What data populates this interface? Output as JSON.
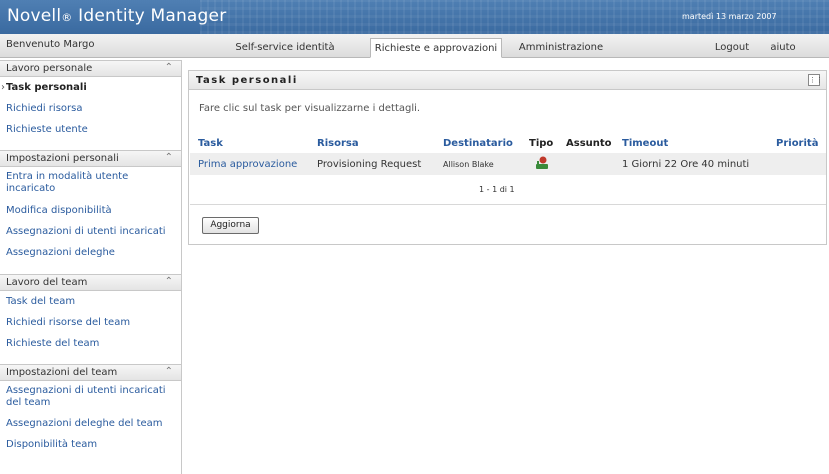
{
  "header": {
    "brand": "Novell",
    "brand_mark": "®",
    "brand_product": "Identity Manager",
    "date": "martedì 13 marzo 2007"
  },
  "nav": {
    "welcome": "Benvenuto Margo",
    "tabs": [
      {
        "label": "Self-service identità",
        "active": false
      },
      {
        "label": "Richieste e approvazioni",
        "active": true
      },
      {
        "label": "Amministrazione",
        "active": false
      }
    ],
    "logout": "Logout",
    "help": "aiuto"
  },
  "sidebar": {
    "sections": [
      {
        "title": "Lavoro personale",
        "items": [
          "Task personali",
          "Richiedi risorsa",
          "Richieste utente"
        ]
      },
      {
        "title": "Impostazioni personali",
        "items": [
          "Entra in modalità utente incaricato",
          "Modifica disponibilità",
          "Assegnazioni di utenti incaricati",
          "Assegnazioni deleghe"
        ]
      },
      {
        "title": "Lavoro del team",
        "items": [
          "Task del team",
          "Richiedi risorse del team",
          "Richieste del team"
        ]
      },
      {
        "title": "Impostazioni del team",
        "items": [
          "Assegnazioni di utenti incaricati del team",
          "Assegnazioni deleghe del team",
          "Disponibilità team"
        ]
      }
    ],
    "selected": "Task personali",
    "collapse_glyph": "⌃"
  },
  "panel": {
    "title": "Task personali",
    "icon": "grid-icon",
    "instructions": "Fare clic sul task per visualizzarne i dettagli.",
    "columns": [
      "Task",
      "Risorsa",
      "Destinatario",
      "Tipo",
      "Assunto",
      "Timeout",
      "Priorità"
    ],
    "rows": [
      {
        "task": "Prima approvazione",
        "resource": "Provisioning Request",
        "recipient": "Allison Blake",
        "type_icon": "approval-type-icon",
        "assigned": "",
        "timeout": "1 Giorni 22 Ore 40 minuti",
        "priority": ""
      }
    ],
    "pager": "1 - 1 di 1",
    "refresh_button": "Aggiorna"
  },
  "colors": {
    "banner": "#3a6aa0",
    "link": "#2a5b9e",
    "row_bg": "#eeeeee"
  }
}
